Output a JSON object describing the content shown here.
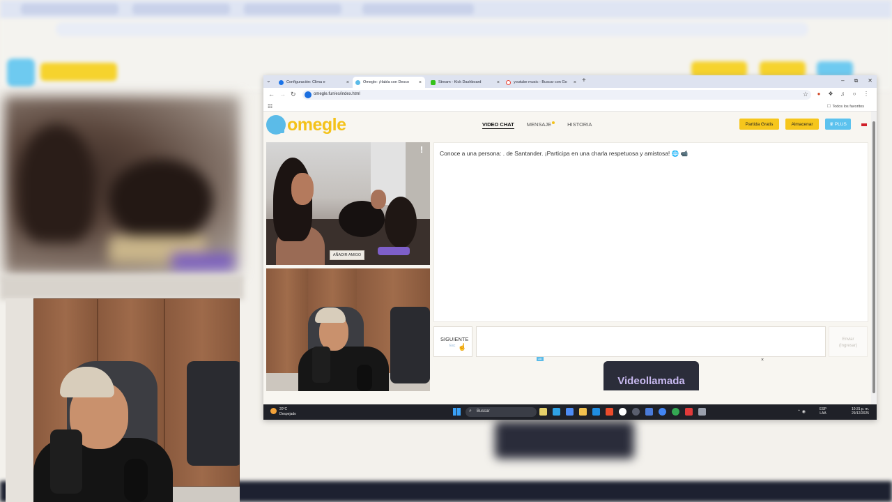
{
  "browser": {
    "tabs": [
      {
        "label": "Configuración: Clima e",
        "favicon_color": "#1a73e8",
        "active": false
      },
      {
        "label": "Omegle: ¡Habla con Desco",
        "favicon_color": "#5bbbe8",
        "active": true
      },
      {
        "label": "Stream - Kick Dashboard",
        "favicon_color": "#33c21a",
        "active": false
      },
      {
        "label": "youtube music - Buscar con Go",
        "favicon_color": "#ea4335",
        "active": false
      }
    ],
    "url": "omegle.fun/es/index.html",
    "all_bookmarks": "Todos los favoritos"
  },
  "site": {
    "logo": "omegle",
    "nav": {
      "video_chat": "VIDEO CHAT",
      "messages": "MENSAJE",
      "history": "HISTORIA"
    },
    "buttons": {
      "free_game": "Partida Gratis",
      "store": "Almacenar",
      "plus": "♛ PLUS"
    }
  },
  "video": {
    "report": "!",
    "add_friend": "AÑADIR AMIGO"
  },
  "chat": {
    "message": "Conoce a una persona: . de Santander. ¡Participa en una charla respetuosa y amistosa! 🌐 📹",
    "next_button": "SIGUIENTE",
    "next_sub": "Esc",
    "input_placeholder": "",
    "send_button": "Enviar\n(Ingresar)"
  },
  "ad": {
    "badge": "AD",
    "close": "×",
    "banner": "Videollamada"
  },
  "taskbar": {
    "weather_temp": "20°C",
    "weather_desc": "Despejado",
    "search": "Buscar",
    "lang1": "ESP",
    "lang2": "LAA",
    "time": "10:31 p. m.",
    "date": "29/12/2025"
  },
  "colors": {
    "accent_yellow": "#f6c61c",
    "accent_blue": "#5cc2ee",
    "taskbar": "#1f2128"
  }
}
